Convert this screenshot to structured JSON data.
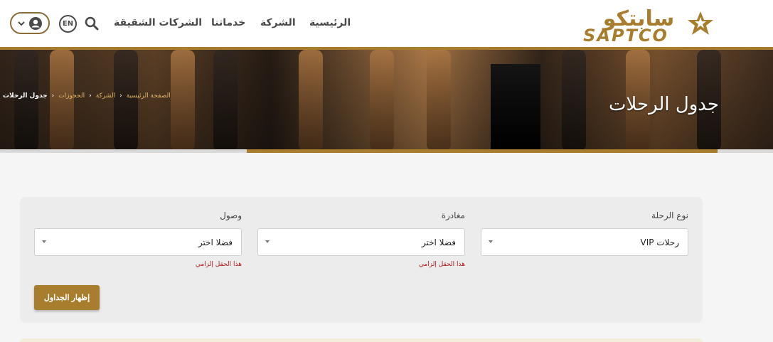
{
  "header": {
    "logo": {
      "arabic": "سابتكو",
      "latin": "SAPTCO"
    },
    "nav": [
      "الرئيسية",
      "الشركة",
      "خدماتنا",
      "الشركات الشقيقة"
    ],
    "lang_label": "EN",
    "icons": {
      "search": "search-icon",
      "user": "user-icon",
      "chevron": "chevron-down-icon"
    }
  },
  "hero": {
    "title": "جدول الرحلات",
    "breadcrumb": [
      "الصفحة الرئيسية",
      "الشركة",
      "الحجوزات",
      "جدول الرحلات"
    ]
  },
  "form": {
    "fields": [
      {
        "label": "نوع الرحلة",
        "value": "رحلات VIP",
        "error": ""
      },
      {
        "label": "مغادرة",
        "value": "فضلا اختر",
        "error": "هذا الحقل إلزامي"
      },
      {
        "label": "وصول",
        "value": "فضلا اختر",
        "error": "هذا الحقل إلزامي"
      }
    ],
    "submit_label": "إظهار الجداول"
  },
  "colors": {
    "accent": "#a87e2e",
    "error": "#b51c1c",
    "text": "#4a4a4a"
  }
}
